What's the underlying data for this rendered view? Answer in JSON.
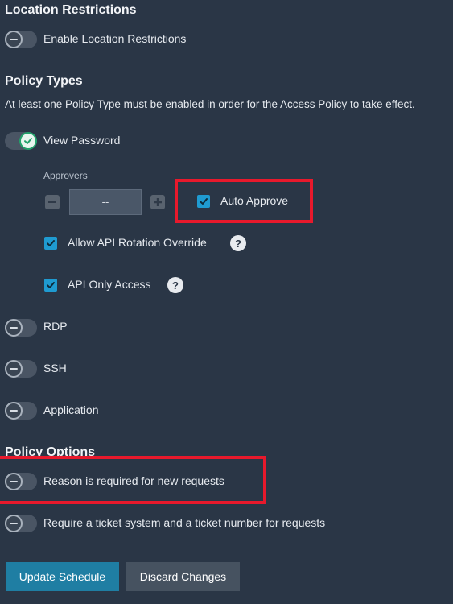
{
  "location": {
    "title": "Location Restrictions",
    "enable_label": "Enable Location Restrictions",
    "enable_on": false
  },
  "policy_types": {
    "title": "Policy Types",
    "description": "At least one Policy Type must be enabled in order for the Access Policy to take effect.",
    "view_password": {
      "label": "View Password",
      "on": true,
      "approvers_label": "Approvers",
      "approvers_value": "--",
      "auto_approve_label": "Auto Approve",
      "auto_approve_checked": true,
      "api_rotation_label": "Allow API Rotation Override",
      "api_rotation_checked": true,
      "api_only_label": "API Only Access",
      "api_only_checked": true,
      "help_glyph": "?"
    },
    "rdp_label": "RDP",
    "ssh_label": "SSH",
    "application_label": "Application"
  },
  "policy_options": {
    "title": "Policy Options",
    "reason_label": "Reason is required for new requests",
    "ticket_label": "Require a ticket system and a ticket number for requests"
  },
  "actions": {
    "update_label": "Update Schedule",
    "discard_label": "Discard Changes"
  },
  "colors": {
    "background": "#2a3646",
    "accent": "#1f9bd1",
    "toggle_on": "#23a26b",
    "highlight": "#e8192c",
    "primary_button": "#1f7ea3"
  }
}
